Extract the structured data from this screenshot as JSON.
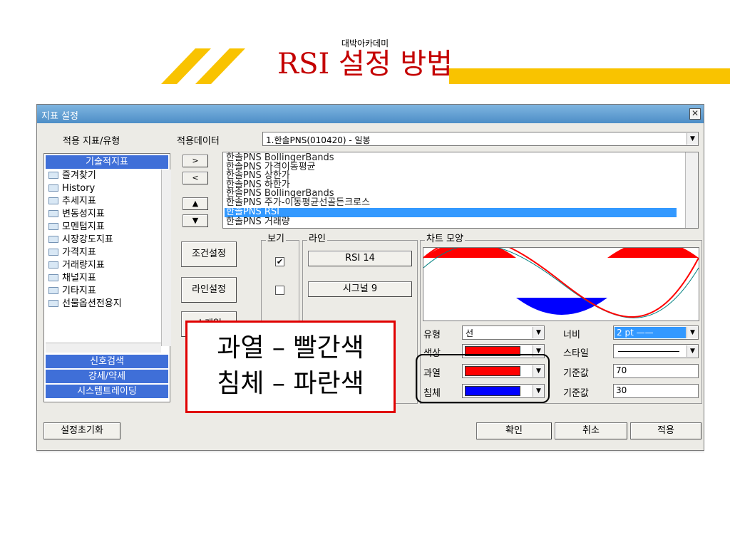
{
  "header": {
    "brand": "대박아카데미",
    "title": "RSI 설정 방법"
  },
  "dialog": {
    "title": "지표 설정",
    "close_icon": "✕",
    "left_panel": {
      "label": "적용 지표/유형",
      "category_active": "기술적지표",
      "tree": [
        "즐겨찾기",
        "History",
        "추세지표",
        "변동성지표",
        "모멘텀지표",
        "시장강도지표",
        "가격지표",
        "거래량지표",
        "채널지표",
        "기타지표",
        "선물옵션전용지"
      ],
      "categories_bottom": [
        "신호검색",
        "강세/약세",
        "시스템트레이딩"
      ]
    },
    "source": {
      "label": "적용데이터",
      "value": "1.한솔PNS(010420) - 일봉"
    },
    "move_buttons": [
      ">",
      "<",
      "▲",
      "▼"
    ],
    "indicator_list": [
      "한솔PNS BollingerBands",
      "한솔PNS 가격이동평균",
      "한솔PNS 상한가",
      "한솔PNS 하한가",
      "한솔PNS BollingerBands",
      "한솔PNS 주가-이동평균선골든크로스",
      "한솔PNS RSI",
      "한솔PNS 거래량"
    ],
    "selected_index": 6,
    "side_buttons": [
      "조건설정",
      "라인설정",
      "스케일"
    ],
    "groups": {
      "view_label": "보기",
      "line_label": "라인",
      "chart_label": "차트 모양"
    },
    "checks": [
      "✔",
      ""
    ],
    "lines": [
      "RSI 14",
      "시그널 9"
    ],
    "props": {
      "type_label": "유형",
      "type_value": "선",
      "color_label": "색상",
      "overbought_label": "과열",
      "oversold_label": "침체",
      "width_label": "너비",
      "width_value": "2 pt",
      "style_label": "스타일",
      "base_label": "기준값",
      "overbought_value": "70",
      "oversold_value": "30"
    },
    "colors": {
      "line": "#ff0000",
      "overbought": "#ff0000",
      "oversold": "#0000ff"
    },
    "footer": {
      "reset": "설정초기화",
      "ok": "확인",
      "cancel": "취소",
      "apply": "적용"
    }
  },
  "annotation": {
    "line1": "과열 – 빨간색",
    "line2": "침체 – 파란색"
  }
}
